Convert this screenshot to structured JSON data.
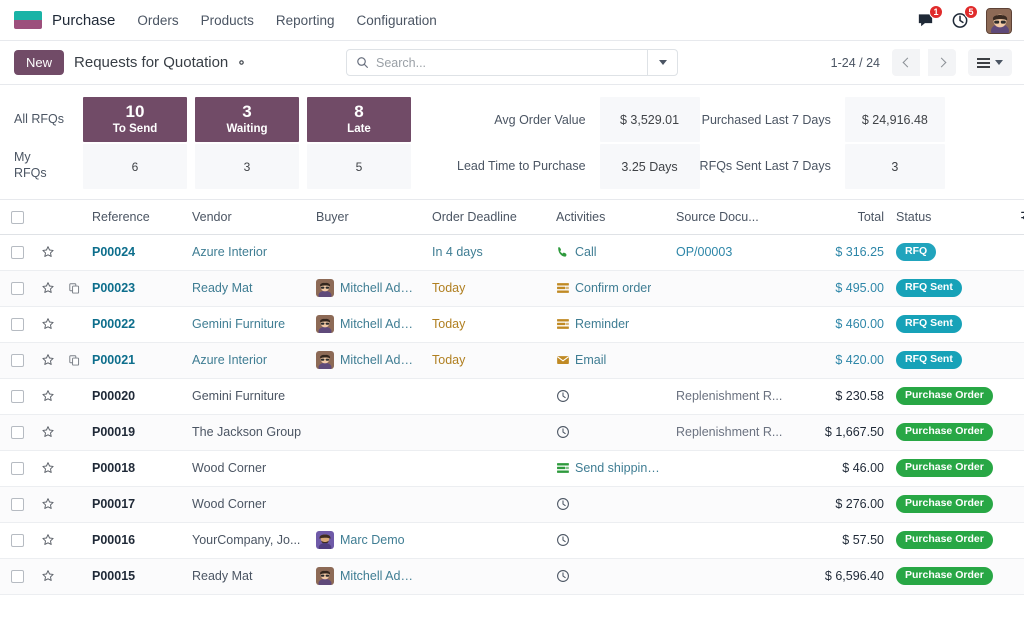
{
  "navbar": {
    "brand": "Purchase",
    "menu": [
      {
        "label": "Orders"
      },
      {
        "label": "Products"
      },
      {
        "label": "Reporting"
      },
      {
        "label": "Configuration"
      }
    ],
    "messages_badge": "1",
    "activities_badge": "5",
    "icons": {
      "messages": "chat-icon",
      "activities": "clock-icon",
      "avatar": "user-avatar"
    }
  },
  "control_panel": {
    "new_label": "New",
    "title": "Requests for Quotation",
    "settings_icon": "gear-icon",
    "search": {
      "placeholder": "Search...",
      "value": "",
      "icon": "search-icon",
      "dropdown_icon": "chevron-down-icon"
    },
    "pager": "1-24 / 24",
    "prev_icon": "chevron-left-icon",
    "next_icon": "chevron-right-icon",
    "view_switch_icon": "list-view-icon"
  },
  "dashboard": {
    "row_labels": [
      "All RFQs",
      "My\nRFQs"
    ],
    "columns": [
      {
        "label": "To Send",
        "all": "10",
        "mine": "6"
      },
      {
        "label": "Waiting",
        "all": "3",
        "mine": "3"
      },
      {
        "label": "Late",
        "all": "8",
        "mine": "5"
      }
    ],
    "kpis": [
      {
        "label": "Avg Order Value",
        "value": "$ 3,529.01"
      },
      {
        "label": "Lead Time to Purchase",
        "value": "3.25 Days"
      },
      {
        "label": "Purchased Last 7 Days",
        "value": "$ 24,916.48"
      },
      {
        "label": "RFQs Sent Last 7 Days",
        "value": "3"
      }
    ],
    "accent_color": "#714B67"
  },
  "list": {
    "columns": [
      "Reference",
      "Vendor",
      "Buyer",
      "Order Deadline",
      "Activities",
      "Source Docu...",
      "Total",
      "Status"
    ],
    "optional_columns_icon": "sliders-icon",
    "select_all_icon": "checkbox-icon",
    "rows": [
      {
        "reference": "P00024",
        "ref_link": true,
        "duplicate": false,
        "vendor": "Azure Interior",
        "vendor_link": true,
        "buyer": "",
        "buyer_avatar": "",
        "deadline": "In 4 days",
        "deadline_style": "soon",
        "activity": "Call",
        "activity_icon": "phone-icon",
        "source": "OP/00003",
        "source_link": true,
        "total": "$ 316.25",
        "total_link": true,
        "status": "RFQ",
        "status_class": "rfq"
      },
      {
        "reference": "P00023",
        "ref_link": true,
        "duplicate": true,
        "vendor": "Ready Mat",
        "vendor_link": true,
        "buyer": "Mitchell Admin",
        "buyer_avatar": "mitchell",
        "deadline": "Today",
        "deadline_style": "today",
        "activity": "Confirm order",
        "activity_icon": "list-orange-icon",
        "source": "",
        "source_link": false,
        "total": "$ 495.00",
        "total_link": true,
        "status": "RFQ Sent",
        "status_class": "rfq_sent"
      },
      {
        "reference": "P00022",
        "ref_link": true,
        "duplicate": false,
        "vendor": "Gemini Furniture",
        "vendor_link": true,
        "buyer": "Mitchell Admin",
        "buyer_avatar": "mitchell",
        "deadline": "Today",
        "deadline_style": "today",
        "activity": "Reminder",
        "activity_icon": "list-orange-icon",
        "source": "",
        "source_link": false,
        "total": "$ 460.00",
        "total_link": true,
        "status": "RFQ Sent",
        "status_class": "rfq_sent"
      },
      {
        "reference": "P00021",
        "ref_link": true,
        "duplicate": true,
        "vendor": "Azure Interior",
        "vendor_link": true,
        "buyer": "Mitchell Admin",
        "buyer_avatar": "mitchell",
        "deadline": "Today",
        "deadline_style": "today",
        "activity": "Email",
        "activity_icon": "envelope-icon",
        "source": "",
        "source_link": false,
        "total": "$ 420.00",
        "total_link": true,
        "status": "RFQ Sent",
        "status_class": "rfq_sent"
      },
      {
        "reference": "P00020",
        "ref_link": false,
        "duplicate": false,
        "vendor": "Gemini Furniture",
        "vendor_link": false,
        "buyer": "",
        "buyer_avatar": "",
        "deadline": "",
        "deadline_style": "",
        "activity": "",
        "activity_icon": "clock-outline-icon",
        "source": "Replenishment R...",
        "source_link": false,
        "total": "$ 230.58",
        "total_link": false,
        "status": "Purchase Order",
        "status_class": "po"
      },
      {
        "reference": "P00019",
        "ref_link": false,
        "duplicate": false,
        "vendor": "The Jackson Group",
        "vendor_link": false,
        "buyer": "",
        "buyer_avatar": "",
        "deadline": "",
        "deadline_style": "",
        "activity": "",
        "activity_icon": "clock-outline-icon",
        "source": "Replenishment R...",
        "source_link": false,
        "total": "$ 1,667.50",
        "total_link": false,
        "status": "Purchase Order",
        "status_class": "po"
      },
      {
        "reference": "P00018",
        "ref_link": false,
        "duplicate": false,
        "vendor": "Wood Corner",
        "vendor_link": false,
        "buyer": "",
        "buyer_avatar": "",
        "deadline": "",
        "deadline_style": "",
        "activity": "Send shipping...",
        "activity_icon": "list-green-icon",
        "source": "",
        "source_link": false,
        "total": "$ 46.00",
        "total_link": false,
        "status": "Purchase Order",
        "status_class": "po"
      },
      {
        "reference": "P00017",
        "ref_link": false,
        "duplicate": false,
        "vendor": "Wood Corner",
        "vendor_link": false,
        "buyer": "",
        "buyer_avatar": "",
        "deadline": "",
        "deadline_style": "",
        "activity": "",
        "activity_icon": "clock-outline-icon",
        "source": "",
        "source_link": false,
        "total": "$ 276.00",
        "total_link": false,
        "status": "Purchase Order",
        "status_class": "po"
      },
      {
        "reference": "P00016",
        "ref_link": false,
        "duplicate": false,
        "vendor": "YourCompany, Jo...",
        "vendor_link": false,
        "buyer": "Marc Demo",
        "buyer_avatar": "marc",
        "deadline": "",
        "deadline_style": "",
        "activity": "",
        "activity_icon": "clock-outline-icon",
        "source": "",
        "source_link": false,
        "total": "$ 57.50",
        "total_link": false,
        "status": "Purchase Order",
        "status_class": "po"
      },
      {
        "reference": "P00015",
        "ref_link": false,
        "duplicate": false,
        "vendor": "Ready Mat",
        "vendor_link": false,
        "buyer": "Mitchell Admin",
        "buyer_avatar": "mitchell",
        "deadline": "",
        "deadline_style": "",
        "activity": "",
        "activity_icon": "clock-outline-icon",
        "source": "",
        "source_link": false,
        "total": "$ 6,596.40",
        "total_link": false,
        "status": "Purchase Order",
        "status_class": "po"
      }
    ]
  },
  "colors": {
    "odoo_purple": "#714B67",
    "badge_rfq": "#21a4bd",
    "badge_rfq_sent": "#17a2b8",
    "badge_purchase_order": "#28a745",
    "link_blue": "#0d6e8c",
    "deadline_today": "#b07f20"
  }
}
